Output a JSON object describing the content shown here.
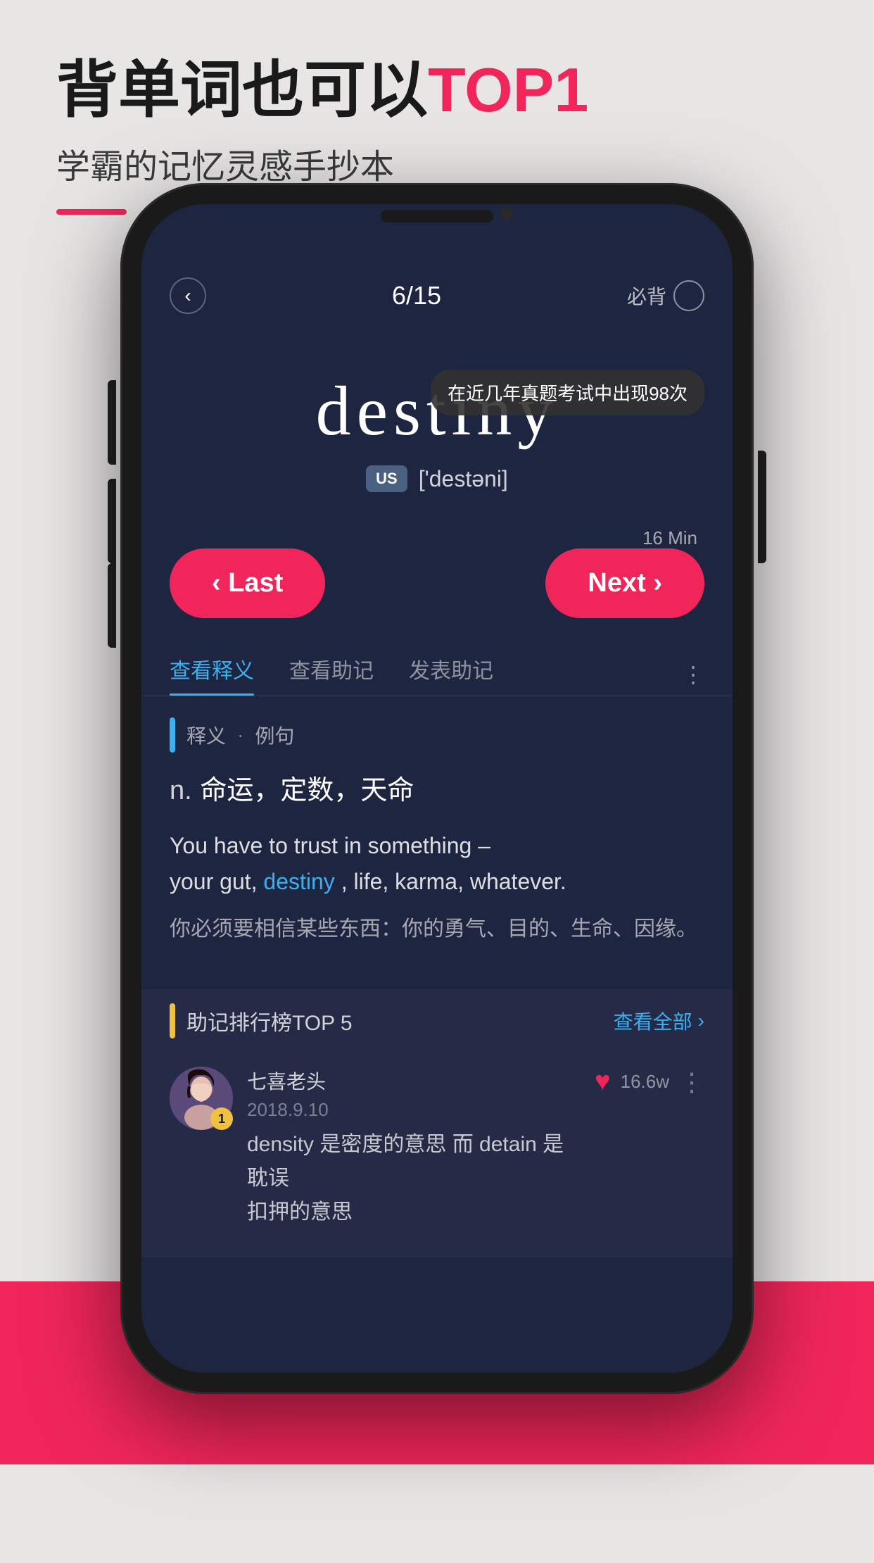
{
  "background_color": "#e8e5e5",
  "top": {
    "title_prefix": "背单词也可以",
    "title_highlight": "TOP1",
    "subtitle": "学霸的记忆灵感手抄本",
    "accent_color": "#f0265a"
  },
  "phone": {
    "screen_bg": "#1e2540"
  },
  "flashcard": {
    "back_btn": "‹",
    "progress": "6/15",
    "must_memorize_label": "必背",
    "tooltip": "在近几年真题考试中出现98次",
    "word": "destiny",
    "us_label": "US",
    "phonetic": "['destəni]",
    "time_label": "16 Min",
    "btn_last": "‹ Last",
    "btn_next": "Next ›",
    "tabs": [
      {
        "label": "查看释义",
        "active": true
      },
      {
        "label": "查看助记",
        "active": false
      },
      {
        "label": "发表助记",
        "active": false
      }
    ],
    "tab_more": "⋮",
    "definition_header": "释义",
    "definition_dot": "·",
    "definition_example": "例句",
    "part_of_speech": "n.",
    "meaning_cn": "命运，定数，天命",
    "example_en_1": "You have to trust in something –",
    "example_en_2": "your gut,",
    "example_highlight": "destiny",
    "example_en_3": ", life, karma, whatever.",
    "example_cn": "你必须要相信某些东西：你的勇气、目的、生命、因缘。",
    "mnemonic_title": "助记排行榜TOP 5",
    "view_all": "查看全部",
    "user": {
      "name": "七喜老头",
      "date": "2018.9.10",
      "badge": "1",
      "comment_1": "density 是密度的意思  而 detain 是耽误",
      "comment_2": "扣押的意思",
      "like_count": "16.6w"
    }
  }
}
